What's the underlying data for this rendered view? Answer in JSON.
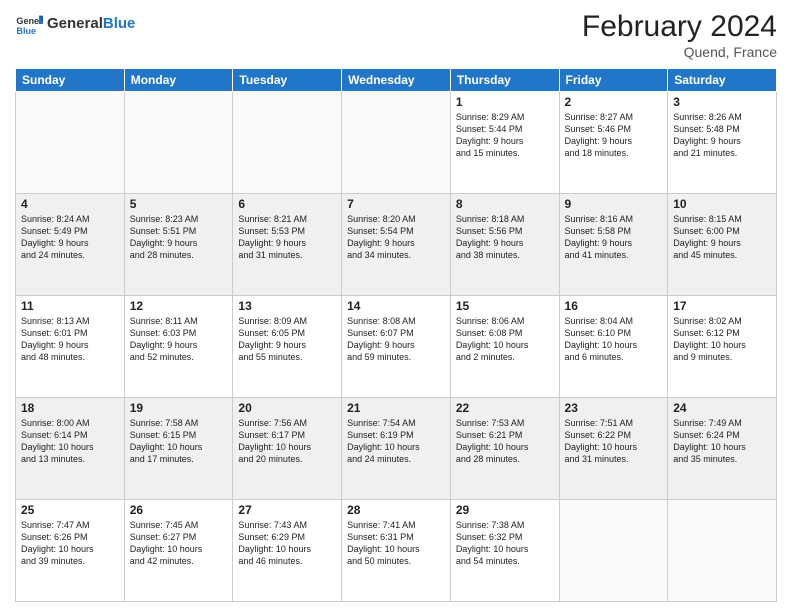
{
  "header": {
    "logo_general": "General",
    "logo_blue": "Blue",
    "month_year": "February 2024",
    "location": "Quend, France"
  },
  "days_of_week": [
    "Sunday",
    "Monday",
    "Tuesday",
    "Wednesday",
    "Thursday",
    "Friday",
    "Saturday"
  ],
  "weeks": [
    [
      {
        "day": "",
        "info": ""
      },
      {
        "day": "",
        "info": ""
      },
      {
        "day": "",
        "info": ""
      },
      {
        "day": "",
        "info": ""
      },
      {
        "day": "1",
        "info": "Sunrise: 8:29 AM\nSunset: 5:44 PM\nDaylight: 9 hours\nand 15 minutes."
      },
      {
        "day": "2",
        "info": "Sunrise: 8:27 AM\nSunset: 5:46 PM\nDaylight: 9 hours\nand 18 minutes."
      },
      {
        "day": "3",
        "info": "Sunrise: 8:26 AM\nSunset: 5:48 PM\nDaylight: 9 hours\nand 21 minutes."
      }
    ],
    [
      {
        "day": "4",
        "info": "Sunrise: 8:24 AM\nSunset: 5:49 PM\nDaylight: 9 hours\nand 24 minutes."
      },
      {
        "day": "5",
        "info": "Sunrise: 8:23 AM\nSunset: 5:51 PM\nDaylight: 9 hours\nand 28 minutes."
      },
      {
        "day": "6",
        "info": "Sunrise: 8:21 AM\nSunset: 5:53 PM\nDaylight: 9 hours\nand 31 minutes."
      },
      {
        "day": "7",
        "info": "Sunrise: 8:20 AM\nSunset: 5:54 PM\nDaylight: 9 hours\nand 34 minutes."
      },
      {
        "day": "8",
        "info": "Sunrise: 8:18 AM\nSunset: 5:56 PM\nDaylight: 9 hours\nand 38 minutes."
      },
      {
        "day": "9",
        "info": "Sunrise: 8:16 AM\nSunset: 5:58 PM\nDaylight: 9 hours\nand 41 minutes."
      },
      {
        "day": "10",
        "info": "Sunrise: 8:15 AM\nSunset: 6:00 PM\nDaylight: 9 hours\nand 45 minutes."
      }
    ],
    [
      {
        "day": "11",
        "info": "Sunrise: 8:13 AM\nSunset: 6:01 PM\nDaylight: 9 hours\nand 48 minutes."
      },
      {
        "day": "12",
        "info": "Sunrise: 8:11 AM\nSunset: 6:03 PM\nDaylight: 9 hours\nand 52 minutes."
      },
      {
        "day": "13",
        "info": "Sunrise: 8:09 AM\nSunset: 6:05 PM\nDaylight: 9 hours\nand 55 minutes."
      },
      {
        "day": "14",
        "info": "Sunrise: 8:08 AM\nSunset: 6:07 PM\nDaylight: 9 hours\nand 59 minutes."
      },
      {
        "day": "15",
        "info": "Sunrise: 8:06 AM\nSunset: 6:08 PM\nDaylight: 10 hours\nand 2 minutes."
      },
      {
        "day": "16",
        "info": "Sunrise: 8:04 AM\nSunset: 6:10 PM\nDaylight: 10 hours\nand 6 minutes."
      },
      {
        "day": "17",
        "info": "Sunrise: 8:02 AM\nSunset: 6:12 PM\nDaylight: 10 hours\nand 9 minutes."
      }
    ],
    [
      {
        "day": "18",
        "info": "Sunrise: 8:00 AM\nSunset: 6:14 PM\nDaylight: 10 hours\nand 13 minutes."
      },
      {
        "day": "19",
        "info": "Sunrise: 7:58 AM\nSunset: 6:15 PM\nDaylight: 10 hours\nand 17 minutes."
      },
      {
        "day": "20",
        "info": "Sunrise: 7:56 AM\nSunset: 6:17 PM\nDaylight: 10 hours\nand 20 minutes."
      },
      {
        "day": "21",
        "info": "Sunrise: 7:54 AM\nSunset: 6:19 PM\nDaylight: 10 hours\nand 24 minutes."
      },
      {
        "day": "22",
        "info": "Sunrise: 7:53 AM\nSunset: 6:21 PM\nDaylight: 10 hours\nand 28 minutes."
      },
      {
        "day": "23",
        "info": "Sunrise: 7:51 AM\nSunset: 6:22 PM\nDaylight: 10 hours\nand 31 minutes."
      },
      {
        "day": "24",
        "info": "Sunrise: 7:49 AM\nSunset: 6:24 PM\nDaylight: 10 hours\nand 35 minutes."
      }
    ],
    [
      {
        "day": "25",
        "info": "Sunrise: 7:47 AM\nSunset: 6:26 PM\nDaylight: 10 hours\nand 39 minutes."
      },
      {
        "day": "26",
        "info": "Sunrise: 7:45 AM\nSunset: 6:27 PM\nDaylight: 10 hours\nand 42 minutes."
      },
      {
        "day": "27",
        "info": "Sunrise: 7:43 AM\nSunset: 6:29 PM\nDaylight: 10 hours\nand 46 minutes."
      },
      {
        "day": "28",
        "info": "Sunrise: 7:41 AM\nSunset: 6:31 PM\nDaylight: 10 hours\nand 50 minutes."
      },
      {
        "day": "29",
        "info": "Sunrise: 7:38 AM\nSunset: 6:32 PM\nDaylight: 10 hours\nand 54 minutes."
      },
      {
        "day": "",
        "info": ""
      },
      {
        "day": "",
        "info": ""
      }
    ]
  ]
}
